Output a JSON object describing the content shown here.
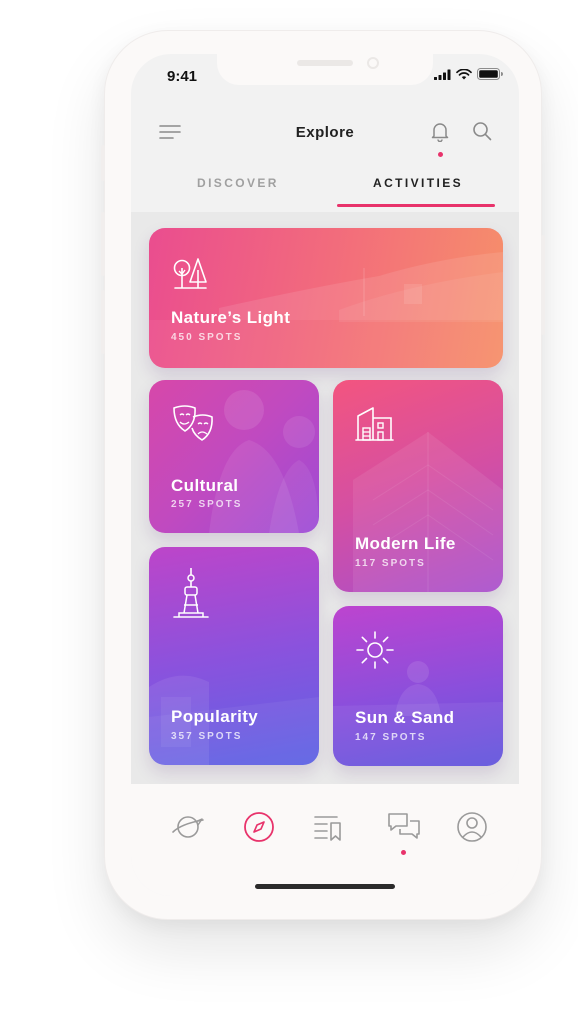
{
  "status_bar": {
    "time": "9:41"
  },
  "header": {
    "title": "Explore"
  },
  "tabs": [
    {
      "label": "DISCOVER",
      "active": false
    },
    {
      "label": "ACTIVITIES",
      "active": true
    }
  ],
  "cards": [
    {
      "name": "Nature’s Light",
      "spots": "450 SPOTS",
      "icon": "trees-icon"
    },
    {
      "name": "Cultural",
      "spots": "257 SPOTS",
      "icon": "theater-masks-icon"
    },
    {
      "name": "Modern Life",
      "spots": "117 SPOTS",
      "icon": "building-icon"
    },
    {
      "name": "Popularity",
      "spots": "357 SPOTS",
      "icon": "tower-icon"
    },
    {
      "name": "Sun & Sand",
      "spots": "147 SPOTS",
      "icon": "sun-icon"
    }
  ],
  "bottom_nav": [
    {
      "icon": "planet-plane-icon",
      "active": false
    },
    {
      "icon": "compass-icon",
      "active": true
    },
    {
      "icon": "list-bookmark-icon",
      "active": false
    },
    {
      "icon": "chat-icon",
      "active": false,
      "badge": true
    },
    {
      "icon": "profile-icon",
      "active": false
    }
  ],
  "colors": {
    "accent": "#e8336b",
    "text": "#222222",
    "muted": "#a0a0a0"
  }
}
